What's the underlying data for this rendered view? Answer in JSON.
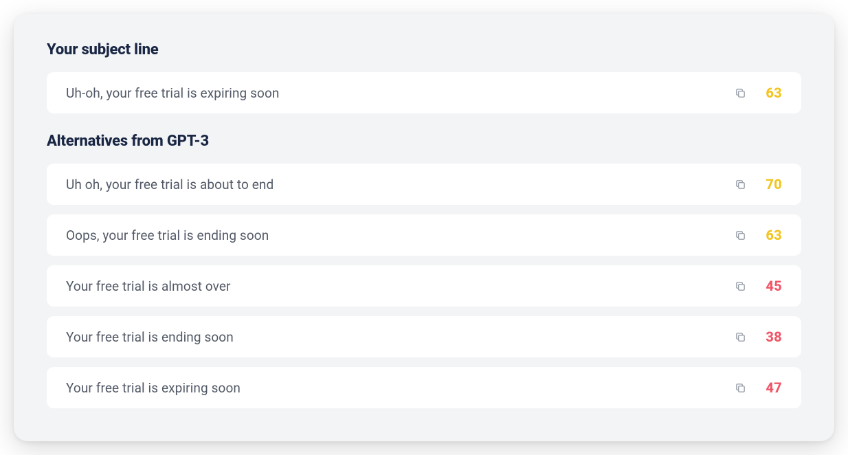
{
  "sections": {
    "subject": {
      "title": "Your subject line",
      "item": {
        "text": "Uh-oh, your free trial is expiring soon",
        "score": 63,
        "scoreClass": "score-yellow"
      }
    },
    "alternatives": {
      "title": "Alternatives from GPT-3",
      "items": [
        {
          "text": "Uh oh, your free trial is about to end",
          "score": 70,
          "scoreClass": "score-yellow"
        },
        {
          "text": "Oops, your free trial is ending soon",
          "score": 63,
          "scoreClass": "score-yellow"
        },
        {
          "text": "Your free trial is almost over",
          "score": 45,
          "scoreClass": "score-red"
        },
        {
          "text": "Your free trial is ending soon",
          "score": 38,
          "scoreClass": "score-red"
        },
        {
          "text": "Your free trial is expiring soon",
          "score": 47,
          "scoreClass": "score-red"
        }
      ]
    }
  },
  "icons": {
    "copy": "copy-icon"
  },
  "colors": {
    "cardBg": "#f3f4f6",
    "rowBg": "#ffffff",
    "titleColor": "#1a2744",
    "textColor": "#525966",
    "iconColor": "#9aa0ab",
    "scoreYellow": "#f2c41d",
    "scoreRed": "#f05668"
  }
}
